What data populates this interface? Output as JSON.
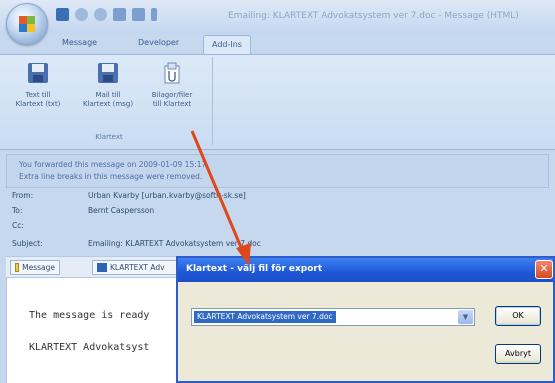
{
  "app": {
    "title": "Emailing: KLARTEXT Advokatsystem ver 7.doc - Message (HTML)"
  },
  "ribbon": {
    "tabs": [
      {
        "label": "Message"
      },
      {
        "label": "Developer"
      },
      {
        "label": "Add-Ins"
      }
    ],
    "buttons": [
      {
        "label": "Text till\nKlartext (txt)"
      },
      {
        "label": "Mail till\nKlartext (msg)"
      },
      {
        "label": "Bilagor/filer\ntill Klartext"
      }
    ],
    "group_label": "Klartext"
  },
  "info_bar": {
    "line1": "You forwarded this message on 2009-01-09 15:17.",
    "line2": "Extra line breaks in this message were removed."
  },
  "header": {
    "from_label": "From:",
    "from_value": "Urban Kvarby [urban.kvarby@softit-sk.se]",
    "to_label": "To:",
    "to_value": "Bernt Caspersson",
    "cc_label": "Cc:",
    "cc_value": "",
    "subject_label": "Subject:",
    "subject_value": "Emailing: KLARTEXT Advokatsystem ver 7.doc"
  },
  "attachments": {
    "message_label": "Message",
    "file_label": "KLARTEXT Adv"
  },
  "body": {
    "line1": "The message is ready",
    "line2": "KLARTEXT Advokatsyst"
  },
  "dialog": {
    "title": "Klartext - välj fil för export",
    "selected_file": "KLARTEXT Advokatsystem ver 7.doc",
    "ok_label": "OK",
    "cancel_label": "Avbryt",
    "close_symbol": "✕"
  },
  "colors": {
    "accent": "#2c5dc8",
    "annotation_arrow": "#e0481b"
  }
}
